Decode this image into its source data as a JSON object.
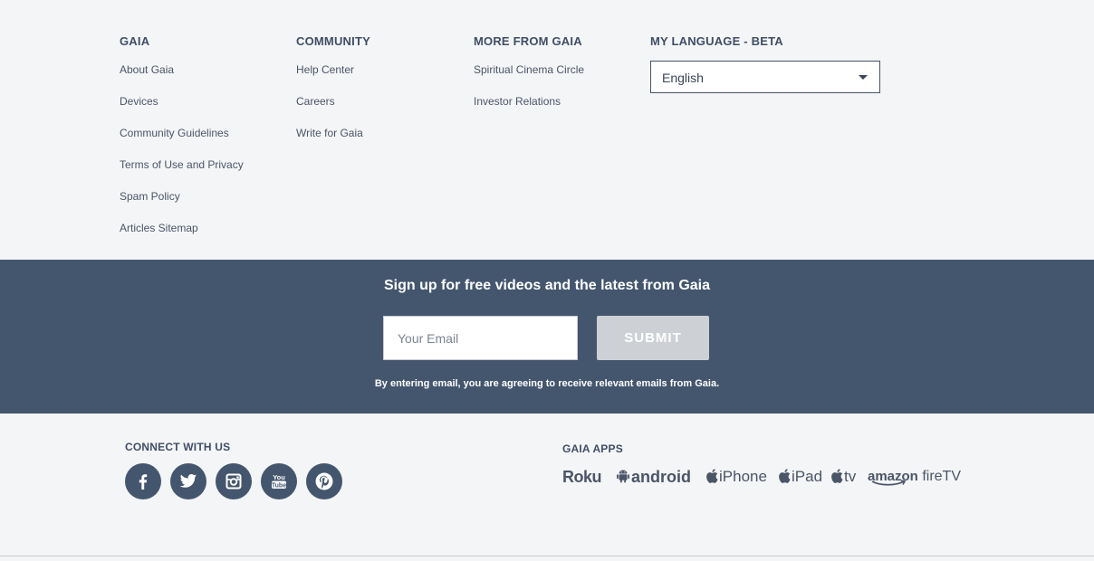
{
  "footer_columns": [
    {
      "title": "GAIA",
      "links": [
        "About Gaia",
        "Devices",
        "Community Guidelines",
        "Terms of Use and Privacy",
        "Spam Policy",
        "Articles Sitemap"
      ]
    },
    {
      "title": "COMMUNITY",
      "links": [
        "Help Center",
        "Careers",
        "Write for Gaia"
      ]
    },
    {
      "title": "MORE FROM GAIA",
      "links": [
        "Spiritual Cinema Circle",
        "Investor Relations"
      ]
    },
    {
      "title": "MY LANGUAGE - BETA"
    }
  ],
  "language": {
    "selected": "English"
  },
  "signup": {
    "heading": "Sign up for free videos and the latest from Gaia",
    "email_placeholder": "Your Email",
    "submit_label": "SUBMIT",
    "disclaimer": "By entering email, you are agreeing to receive relevant emails from Gaia."
  },
  "connect": {
    "title": "CONNECT WITH US",
    "icons": [
      "facebook-icon",
      "twitter-icon",
      "instagram-icon",
      "youtube-icon",
      "pinterest-icon"
    ]
  },
  "apps": {
    "title": "GAIA APPS",
    "items": [
      "Roku",
      "android",
      "iPhone",
      "iPad",
      "tv",
      "amazon",
      "fireTV"
    ]
  },
  "colors": {
    "band": "#44566e",
    "background": "#f4f5f6",
    "text": "#485468",
    "submit_bg": "#cdd0d5"
  }
}
